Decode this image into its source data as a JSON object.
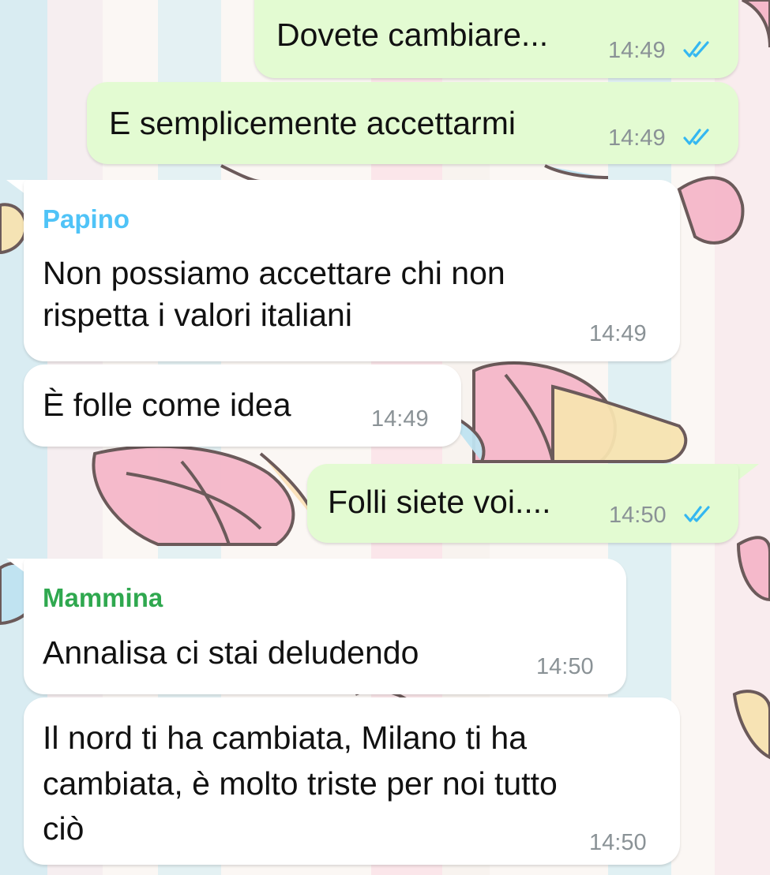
{
  "colors": {
    "outgoing_bubble": "#e3fbd2",
    "incoming_bubble": "#ffffff",
    "timestamp": "#8a9296",
    "read_ticks": "#34b7f1",
    "sender_papino": "#4fc3f7",
    "sender_mammina": "#2fa84f"
  },
  "messages": [
    {
      "direction": "out",
      "text": "Dovete cambiare...",
      "time": "14:49",
      "status": "read",
      "status_icon": "double-check-icon"
    },
    {
      "direction": "out",
      "text": "E semplicemente accettarmi",
      "time": "14:49",
      "status": "read",
      "status_icon": "double-check-icon"
    },
    {
      "direction": "in",
      "sender": "Papino",
      "lines": [
        "Non possiamo accettare chi non",
        "rispetta i valori italiani"
      ],
      "time": "14:49"
    },
    {
      "direction": "in",
      "text": "È folle come idea",
      "time": "14:49"
    },
    {
      "direction": "out",
      "text": "Folli siete voi....",
      "time": "14:50",
      "status": "read",
      "status_icon": "double-check-icon"
    },
    {
      "direction": "in",
      "sender": "Mammina",
      "text": "Annalisa ci stai deludendo",
      "time": "14:50"
    },
    {
      "direction": "in",
      "lines": [
        "Il nord ti ha cambiata, Milano ti ha",
        "cambiata, è molto triste per noi tutto",
        "ciò"
      ],
      "time": "14:50"
    }
  ]
}
